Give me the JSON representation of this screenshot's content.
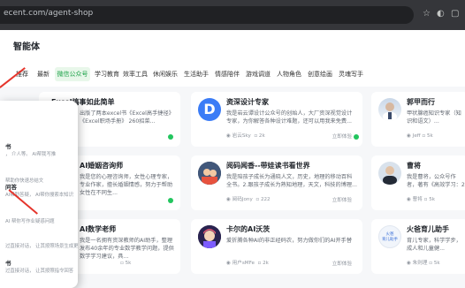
{
  "browser": {
    "url": "ecent.com/agent-shop",
    "icons": [
      "bookmark-star-icon",
      "incognito-icon",
      "split-view-icon"
    ]
  },
  "page": {
    "title": "智能体",
    "tabs": [
      {
        "label": "推荐",
        "active": false
      },
      {
        "label": "最新",
        "active": false
      },
      {
        "label": "微信公众号",
        "active": true
      },
      {
        "label": "学习教育",
        "active": false
      },
      {
        "label": "效率工具",
        "active": false
      },
      {
        "label": "休闲娱乐",
        "active": false
      },
      {
        "label": "生活助手",
        "active": false
      },
      {
        "label": "情感陪伴",
        "active": false
      },
      {
        "label": "游戏调道",
        "active": false
      },
      {
        "label": "人物角色",
        "active": false
      },
      {
        "label": "创意绘画",
        "active": false
      },
      {
        "label": "灵魂写手",
        "active": false
      }
    ]
  },
  "cards": [
    {
      "title": "Excel搞事如此简单",
      "desc": "出版了两本excel书《Excel高手捷径》《Excel职场手册》 260招菜...",
      "author": "",
      "chats": "",
      "online": true
    },
    {
      "title": "资深设计专家",
      "desc": "我是岩云谭设计公众号的创始人，大厂资深视觉设计专家，为你解答各种设计难题，还可以用我来免费...",
      "author": "岩云Sky",
      "chats": "2k",
      "online": true
    },
    {
      "title": "郭甲而行",
      "desc": "甲状腺癌知识专家（知识和语文）...",
      "author": "Jeff",
      "chats": "5k",
      "online": false
    },
    {
      "title": "AI婚姻咨询师",
      "desc": "我是您的心理咨询师，女性心理专家，专业作家，擅长婚姻情感，努力于帮助女性在不同生...",
      "author": "",
      "chats": "",
      "online": true
    },
    {
      "title": "阅码闻香--带娃读书看世界",
      "desc": "我是陪孩子成长为通晓人文，历史，地理的移动百科全书。2.跟孩子成长为熟知地理，天文，科技的博理...",
      "author": "阅码Jony",
      "chats": "222",
      "online": false
    },
    {
      "title": "曹将",
      "desc": "我是曹将，公众号作者，著有《高效学习：2分钟入门》 作者，知乎油媒体“曹将”...",
      "author": "曹将",
      "chats": "5k",
      "online": false
    },
    {
      "title": "AI数学老师",
      "desc": "我是一名拥有资深教师的AI助手，整理发布40余年的专业数学教学问题，提供数学学习建议，具...",
      "author": "",
      "chats": "5k",
      "online": false
    },
    {
      "title": "卡尔的AI沃茨",
      "desc": "爱折腾各种AI的非正经码农，努力做你们的AI开手替",
      "author": "用户sMFe",
      "chats": "2k",
      "online": false
    },
    {
      "title": "火爸育儿助手",
      "desc": "育儿专家，科学学步，成人和儿童健...",
      "author": "朱则理",
      "chats": "5k",
      "online": false
    }
  ],
  "card_meta": {
    "share_label": "立即体验"
  },
  "panel": {
    "items": [
      {
        "title": "书",
        "sub": "， 介人等。 AI帮我写推"
      },
      {
        "title": "",
        "sub": "帮助你快速总结文"
      },
      {
        "title": "问答",
        "sub": "AI帮助答疑， AI帮你搜索本知识"
      },
      {
        "title": "",
        "sub": "AI 帮你写作业疑惑问题"
      },
      {
        "title": "",
        "sub": "过直接对话， 让其按照场景生成更"
      },
      {
        "title": "书",
        "sub": "过直接对话， 让其按照指令回答"
      }
    ]
  },
  "avatars": {
    "design": "D",
    "kid_label": "火爸\n育儿助手"
  }
}
